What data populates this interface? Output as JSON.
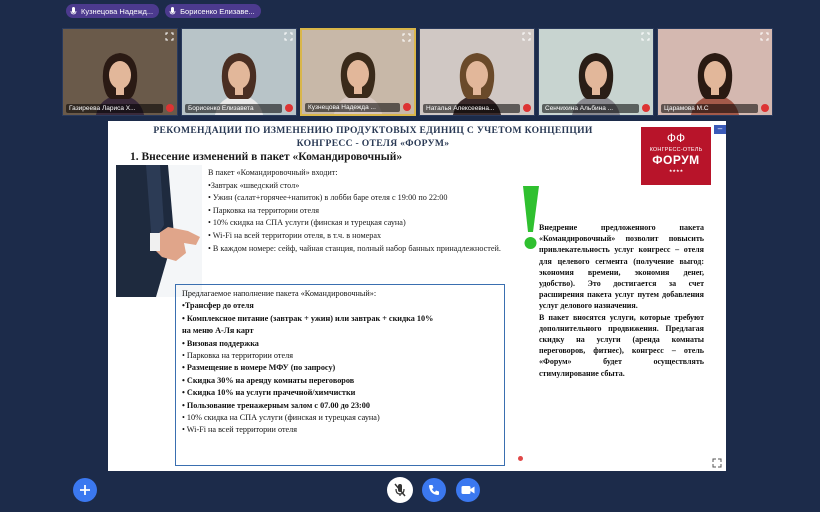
{
  "chips": [
    {
      "label": "Кузнецова Надежд..."
    },
    {
      "label": "Борисенко Елизаве..."
    }
  ],
  "tiles": [
    {
      "name": "Газиреева Лариса Х...",
      "bg": "#6a5a4a",
      "hair": "#2a1a14",
      "shirt": "#3a2a3a"
    },
    {
      "name": "Борисенко Елизавета",
      "bg": "#b8c4c8",
      "hair": "#4a2e22",
      "shirt": "#e8e8e8"
    },
    {
      "name": "Кузнецова Надежда ...",
      "bg": "#c8b8a8",
      "hair": "#3a2a1a",
      "shirt": "#d8c8c0"
    },
    {
      "name": "Наталья Алексеевна...",
      "bg": "#d0c8c4",
      "hair": "#6a4a2a",
      "shirt": "#3a2a2a"
    },
    {
      "name": "Сенчихина Альбина ...",
      "bg": "#c8d4d0",
      "hair": "#2a1e16",
      "shirt": "#8a8a90"
    },
    {
      "name": "Царамова М.С",
      "bg": "#d4b8b0",
      "hair": "#2a1a12",
      "shirt": "#a45a4a"
    }
  ],
  "slide": {
    "title_line1": "Рекомендации по изменению продуктовых единиц с учетом концепции",
    "title_line2": "конгресс - отеля «Форум»",
    "section": "1. Внесение изменений в пакет «Командировочный»",
    "logo": {
      "line1": "КОНГРЕСС-ОТЕЛЬ",
      "line2": "ФОРУМ",
      "line3": "★★★★"
    },
    "included_items": [
      "В пакет «Командировочный» входит:",
      "•Завтрак «шведский стол»",
      "• Ужин (салат+горячее+напиток) в лобби баре отеля с 19:00 по 22:00",
      "• Парковка на территории отеля",
      "• 10% скидка на СПА услуги (финская и турецкая сауна)",
      "• Wi-Fi на всей территории отеля, в т.ч. в номерах",
      "• В каждом номере: сейф, чайная станция, полный набор банных принадлежностей."
    ],
    "proposed_header": "Предлагаемое наполнение пакета «Командировочный»:",
    "proposed_items": [
      {
        "text": "•Трансфер до отеля",
        "bold": true
      },
      {
        "text": "• Комплексное питание (завтрак + ужин) или завтрак + скидка 10%",
        "bold": true
      },
      {
        "text": "на меню А-Ля карт",
        "bold": true
      },
      {
        "text": "• Визовая поддержка",
        "bold": true
      },
      {
        "text": "• Парковка на территории отеля",
        "bold": false
      },
      {
        "text": "• Размещение в номере МФУ (по запросу)",
        "bold": true
      },
      {
        "text": "• Скидка 30% на аренду комнаты переговоров",
        "bold": true
      },
      {
        "text": "• Скидка 10% на услуги прачечной/химчистки",
        "bold": true
      },
      {
        "text": "• Пользование тренажерным залом с 07.00 до 23:00",
        "bold": true
      },
      {
        "text": "• 10% скидка на СПА услуги (финская и турецкая сауна)",
        "bold": false
      },
      {
        "text": "• Wi-Fi на всей территории отеля",
        "bold": false
      }
    ],
    "right_p1": "Внедрение предложенного пакета «Командировочный» позволит повысить привлекательность услуг конгресс – отеля для целевого сегмента (получение выгод: экономия времени, экономия денег, удобство). Это достигается за счет расширения пакета услуг путем добавления услуг делового назначения.",
    "right_p2": "В пакет вносятся услуги, которые требуют дополнительного продвижения. Предлагая скидку на услуги (аренда комнаты переговоров, фитнес), конгресс – отель «Форум» будет осуществлять стимулирование сбыта."
  },
  "colors": {
    "accent": "#3b78f0",
    "chip": "#4c3a8e",
    "logo": "#b8142a",
    "exclamation": "#2fc02f"
  }
}
